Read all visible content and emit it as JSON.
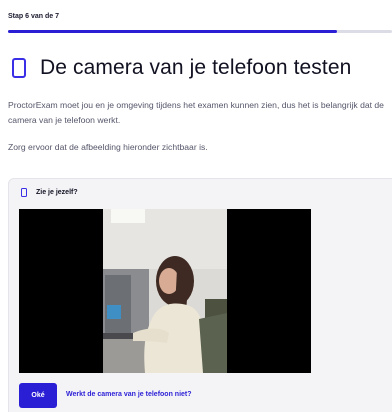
{
  "header": {
    "step_label": "Stap 6 van de 7",
    "progress_fraction": 0.857
  },
  "page": {
    "title": "De camera van je telefoon testen",
    "intro": "ProctorExam moet jou en je omgeving tijdens het examen kunnen zien, dus het is belangrijk dat de camera van je telefoon werkt.",
    "instruction": "Zorg ervoor dat de afbeelding hieronder zichtbaar is."
  },
  "card": {
    "title": "Zie je jezelf?",
    "ok_button": "Oké",
    "help_link": "Werkt de camera van je telefoon niet?"
  },
  "icons": {
    "title_icon": "phone-icon",
    "card_icon": "phone-icon"
  },
  "colors": {
    "accent": "#2b1fd6",
    "text": "#111122",
    "muted": "#55566a",
    "card_bg": "#f4f4f7"
  }
}
